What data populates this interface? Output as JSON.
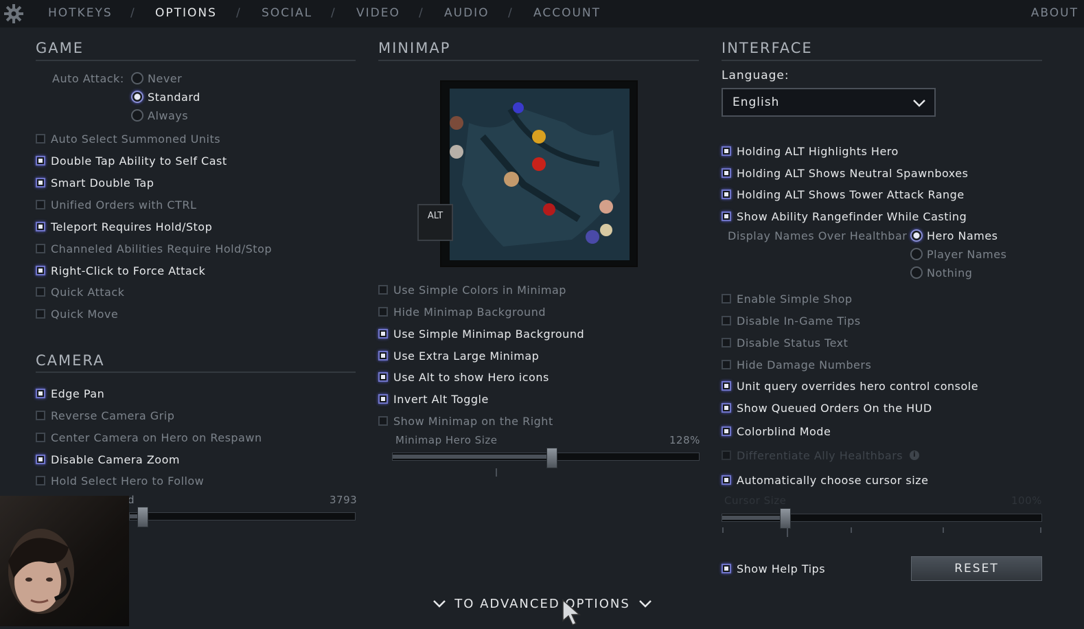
{
  "nav": {
    "items": [
      "HOTKEYS",
      "OPTIONS",
      "SOCIAL",
      "VIDEO",
      "AUDIO",
      "ACCOUNT"
    ],
    "active": "OPTIONS",
    "about": "ABOUT"
  },
  "game": {
    "title": "GAME",
    "auto_attack_label": "Auto Attack:",
    "auto_attack_options": [
      "Never",
      "Standard",
      "Always"
    ],
    "auto_attack_selected": "Standard",
    "options": [
      {
        "label": "Auto Select Summoned Units",
        "checked": false
      },
      {
        "label": "Double Tap Ability to Self Cast",
        "checked": true
      },
      {
        "label": "Smart Double Tap",
        "checked": true
      },
      {
        "label": "Unified Orders with CTRL",
        "checked": false
      },
      {
        "label": "Teleport Requires Hold/Stop",
        "checked": true
      },
      {
        "label": "Channeled Abilities Require Hold/Stop",
        "checked": false
      },
      {
        "label": "Right-Click to Force Attack",
        "checked": true
      },
      {
        "label": "Quick Attack",
        "checked": false
      },
      {
        "label": "Quick Move",
        "checked": false
      }
    ]
  },
  "camera": {
    "title": "CAMERA",
    "options": [
      {
        "label": "Edge Pan",
        "checked": true
      },
      {
        "label": "Reverse Camera Grip",
        "checked": false
      },
      {
        "label": "Center Camera on Hero on Respawn",
        "checked": false
      },
      {
        "label": "Disable Camera Zoom",
        "checked": true
      },
      {
        "label": "Hold Select Hero to Follow",
        "checked": false
      }
    ],
    "slider_label_fragment": "d",
    "slider_value": "3793",
    "slider_fraction": 0.06
  },
  "minimap": {
    "title": "MINIMAP",
    "alt_key": "ALT",
    "options": [
      {
        "label": "Use Simple Colors in Minimap",
        "checked": false
      },
      {
        "label": "Hide Minimap Background",
        "checked": false
      },
      {
        "label": "Use Simple Minimap Background",
        "checked": true
      },
      {
        "label": "Use Extra Large Minimap",
        "checked": true
      },
      {
        "label": "Use Alt to show Hero icons",
        "checked": true
      },
      {
        "label": "Invert Alt Toggle",
        "checked": true
      },
      {
        "label": "Show Minimap on the Right",
        "checked": false
      }
    ],
    "hero_size_label": "Minimap Hero Size",
    "hero_size_value": "128%",
    "hero_size_fraction": 0.52
  },
  "interface": {
    "title": "INTERFACE",
    "language_label": "Language:",
    "language_value": "English",
    "options_top": [
      {
        "label": "Holding ALT Highlights Hero",
        "checked": true
      },
      {
        "label": "Holding ALT Shows Neutral Spawnboxes",
        "checked": true
      },
      {
        "label": "Holding ALT Shows Tower Attack Range",
        "checked": true
      },
      {
        "label": "Show Ability Rangefinder While Casting",
        "checked": true
      }
    ],
    "display_names_label": "Display Names Over Healthbar",
    "display_names_options": [
      "Hero Names",
      "Player Names",
      "Nothing"
    ],
    "display_names_selected": "Hero Names",
    "options_bottom": [
      {
        "label": "Enable Simple Shop",
        "checked": false
      },
      {
        "label": "Disable In-Game Tips",
        "checked": false
      },
      {
        "label": "Disable Status Text",
        "checked": false
      },
      {
        "label": "Hide Damage Numbers",
        "checked": false
      },
      {
        "label": "Unit query overrides hero control console",
        "checked": true
      },
      {
        "label": "Show Queued Orders On the HUD",
        "checked": true
      },
      {
        "label": "Colorblind Mode",
        "checked": true
      },
      {
        "label": "Differentiate Ally Healthbars",
        "checked": false,
        "disabled": true
      },
      {
        "label": "Automatically choose cursor size",
        "checked": true
      }
    ],
    "cursor_size_label": "Cursor Size",
    "cursor_size_value": "100%",
    "cursor_size_fraction": 0.2,
    "show_help_tips": {
      "label": "Show Help Tips",
      "checked": true
    },
    "reset_label": "RESET"
  },
  "footer": {
    "advanced_label": "TO ADVANCED OPTIONS"
  }
}
